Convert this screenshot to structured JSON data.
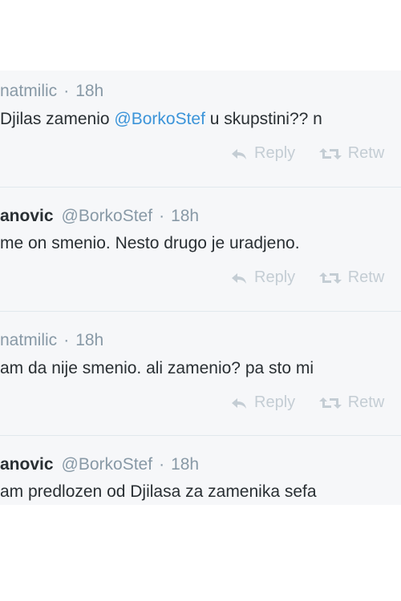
{
  "tweets": [
    {
      "author_fragment": "natmilic",
      "time": "18h",
      "text_before": "Djilas zamenio ",
      "mention": "@BorkoStef",
      "text_after": " u skupstini?? n",
      "actions": {
        "reply": "Reply",
        "retweet": "Retw"
      }
    },
    {
      "fullname_fragment": "anovic",
      "handle": "@BorkoStef",
      "time": "18h",
      "text": "me on smenio. Nesto drugo je uradjeno.",
      "actions": {
        "reply": "Reply",
        "retweet": "Retw"
      }
    },
    {
      "author_fragment": "natmilic",
      "time": "18h",
      "text": "am da nije smenio. ali zamenio? pa sto mi",
      "actions": {
        "reply": "Reply",
        "retweet": "Retw"
      }
    },
    {
      "fullname_fragment": "anovic",
      "handle": "@BorkoStef",
      "time": "18h",
      "text": "am predlozen od Djilasa za zamenika sefa"
    }
  ],
  "icons": {
    "reply": "reply-icon",
    "retweet": "retweet-icon"
  },
  "colors": {
    "mention": "#3b94d9",
    "meta": "#8899a6",
    "text": "#292f33",
    "action": "#c4cdd4",
    "card_bg": "#f6f7f9"
  }
}
